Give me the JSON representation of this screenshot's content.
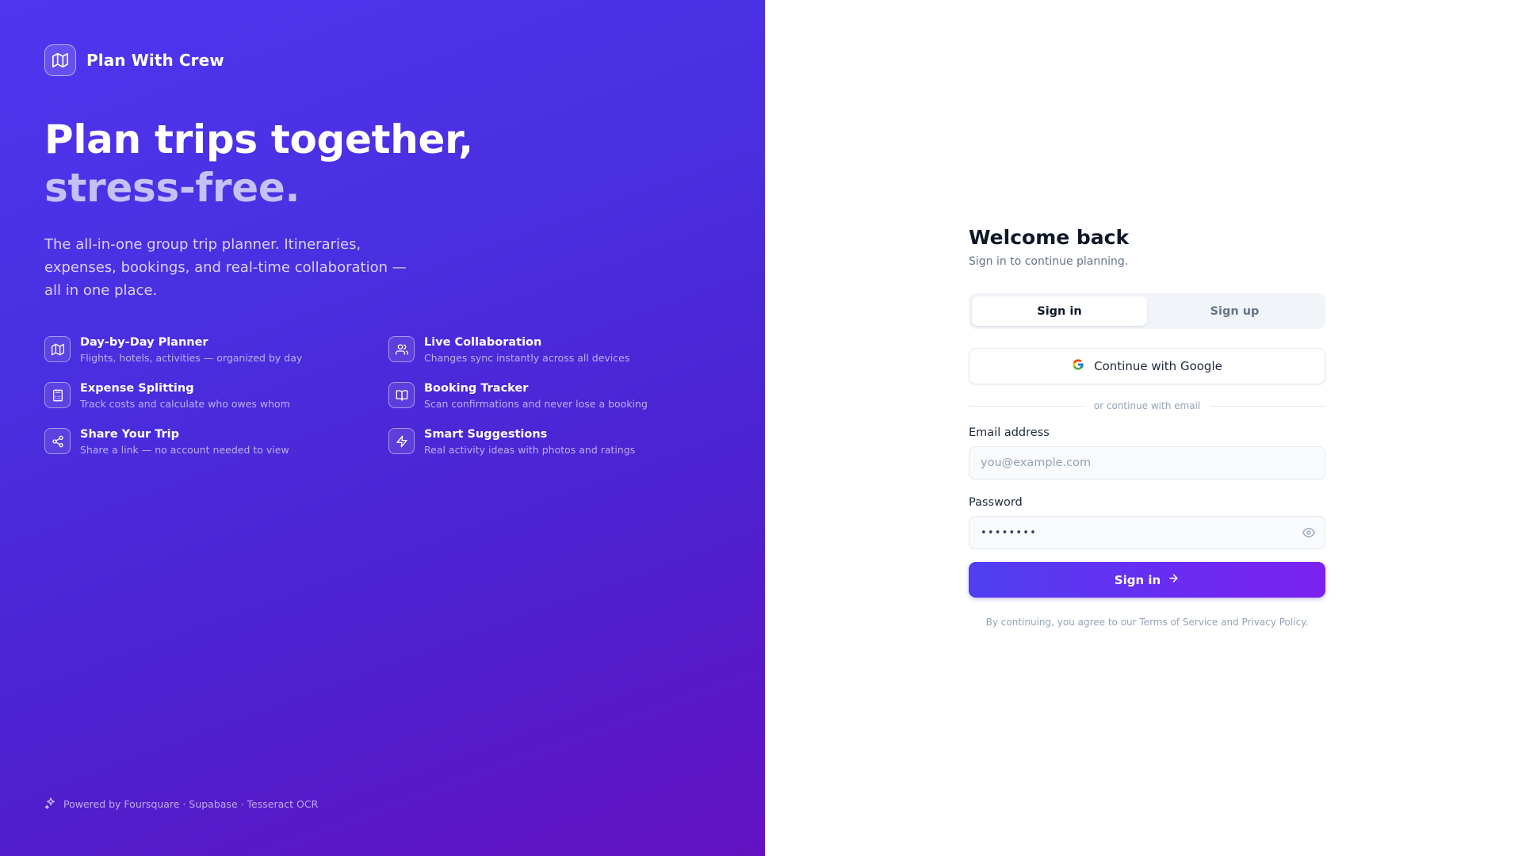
{
  "brand": {
    "name": "Plan With Crew",
    "icon": "map-icon"
  },
  "hero": {
    "headline_line1": "Plan trips together,",
    "headline_line2": "stress-free.",
    "subtitle": "The all-in-one group trip planner. Itineraries, expenses, bookings, and real-time collaboration — all in one place.",
    "features": [
      {
        "title": "Day-by-Day Planner",
        "desc": "Flights, hotels, activities — organized by day",
        "icon": "map-icon"
      },
      {
        "title": "Live Collaboration",
        "desc": "Changes sync instantly across all devices",
        "icon": "users-icon"
      },
      {
        "title": "Expense Splitting",
        "desc": "Track costs and calculate who owes whom",
        "icon": "calculator-icon"
      },
      {
        "title": "Booking Tracker",
        "desc": "Scan confirmations and never lose a booking",
        "icon": "book-open-icon"
      },
      {
        "title": "Share Your Trip",
        "desc": "Share a link — no account needed to view",
        "icon": "share-icon"
      },
      {
        "title": "Smart Suggestions",
        "desc": "Real activity ideas with photos and ratings",
        "icon": "zap-icon"
      }
    ],
    "powered_by": "Powered by Foursquare · Supabase · Tesseract OCR"
  },
  "form": {
    "title": "Welcome back",
    "subtitle": "Sign in to continue planning.",
    "tabs": [
      {
        "label": "Sign in",
        "active": true
      },
      {
        "label": "Sign up",
        "active": false
      }
    ],
    "google_label": "Continue with Google",
    "divider": "or continue with email",
    "email_label": "Email address",
    "email_placeholder": "you@example.com",
    "password_label": "Password",
    "password_value": "••••••••",
    "submit_label": "Sign in",
    "terms": "By continuing, you agree to our Terms of Service and Privacy Policy."
  },
  "colors": {
    "hero_gradient_start": "#4f35f0",
    "hero_gradient_end": "#6412c2",
    "submit_start": "#4f3ff0",
    "submit_end": "#7c22f0",
    "title_text": "#0f172a"
  }
}
